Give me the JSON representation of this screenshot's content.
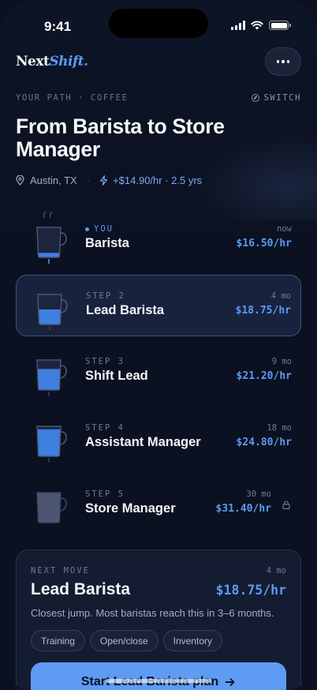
{
  "status_bar": {
    "time": "9:41"
  },
  "header": {
    "logo_main": "Next",
    "logo_accent": "Shift."
  },
  "path": {
    "label": "YOUR PATH · COFFEE",
    "switch_label": "SWITCH"
  },
  "title": "From Barista to Store Manager",
  "meta": {
    "location": "Austin, TX",
    "growth": "+$14.90/hr · 2.5 yrs"
  },
  "steps": [
    {
      "label": "YOU",
      "name": "Barista",
      "time": "now",
      "pay": "$16.50/hr",
      "fill": 0.15,
      "current": true
    },
    {
      "label": "STEP 2",
      "name": "Lead Barista",
      "time": "4 mo",
      "pay": "$18.75/hr",
      "fill": 0.5,
      "selected": true
    },
    {
      "label": "STEP 3",
      "name": "Shift Lead",
      "time": "9 mo",
      "pay": "$21.20/hr",
      "fill": 0.7
    },
    {
      "label": "STEP 4",
      "name": "Assistant Manager",
      "time": "18 mo",
      "pay": "$24.80/hr",
      "fill": 0.9
    },
    {
      "label": "STEP 5",
      "name": "Store Manager",
      "time": "30 mo",
      "pay": "$31.40/hr",
      "fill": 1.0,
      "locked": true
    }
  ],
  "next_move": {
    "label": "NEXT MOVE",
    "time": "4 mo",
    "title": "Lead Barista",
    "pay": "$18.75/hr",
    "description": "Closest jump. Most baristas reach this in 3–6 months.",
    "chips": [
      "Training",
      "Open/close",
      "Inventory"
    ],
    "cta_label": "Start Lead Barista plan"
  },
  "colors": {
    "accent": "#5b9bf5",
    "background": "#0b1120",
    "card": "#141c31",
    "selected_border": "#3b5285"
  },
  "icons": [
    "signal-icon",
    "wifi-icon",
    "battery-icon",
    "more-icon",
    "compass-icon",
    "pin-icon",
    "bolt-icon",
    "cup-icon",
    "steam-icon",
    "lock-icon",
    "arrow-right-icon"
  ]
}
